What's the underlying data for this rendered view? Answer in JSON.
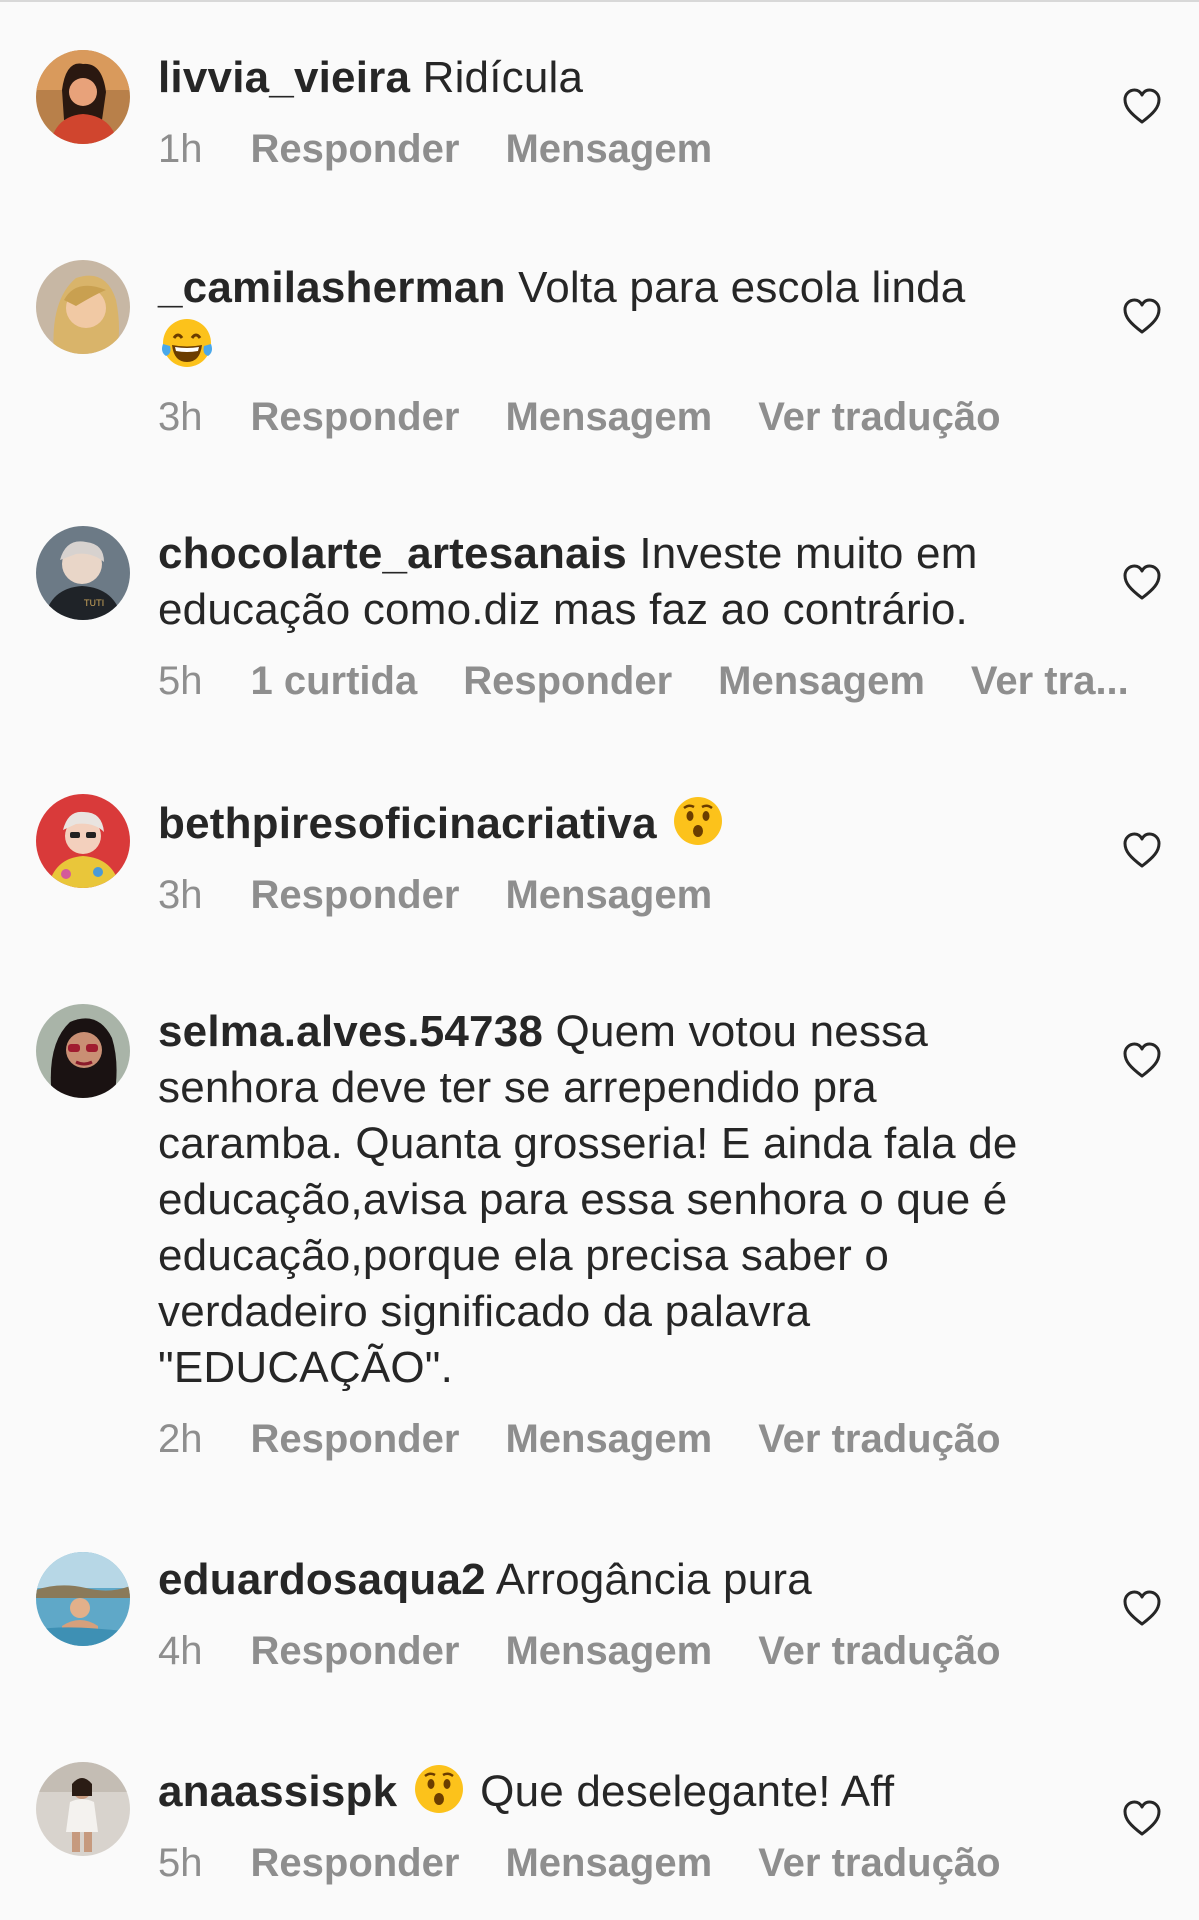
{
  "comments": [
    {
      "username": "livvia_vieira",
      "text": "Ridícula",
      "time": "1h",
      "actions": [
        "Responder",
        "Mensagem"
      ]
    },
    {
      "username": "_camilasherman",
      "text": "Volta para escola linda",
      "emoji": "face-with-tears-of-joy",
      "time": "3h",
      "actions": [
        "Responder",
        "Mensagem",
        "Ver tradução"
      ]
    },
    {
      "username": "chocolarte_artesanais",
      "text": "Investe muito em educação como.diz mas faz ao contrário.",
      "time": "5h",
      "likes": "1 curtida",
      "actions": [
        "Responder",
        "Mensagem",
        "Ver tra..."
      ]
    },
    {
      "username": "bethpiresoficinacriativa",
      "text": "",
      "emoji": "hushed-face",
      "time": "3h",
      "actions": [
        "Responder",
        "Mensagem"
      ]
    },
    {
      "username": "selma.alves.54738",
      "text": "Quem votou nessa senhora deve ter se arrependido pra caramba. Quanta grosseria! E ainda fala de educação,avisa para essa senhora o que é educação,porque ela precisa saber o verdadeiro significado da palavra \"EDUCAÇÃO\".",
      "time": "2h",
      "actions": [
        "Responder",
        "Mensagem",
        "Ver tradução"
      ]
    },
    {
      "username": "eduardosaqua2",
      "text": "Arrogância pura",
      "time": "4h",
      "actions": [
        "Responder",
        "Mensagem",
        "Ver tradução"
      ]
    },
    {
      "username": "anaassispk",
      "text": "Que deselegante! Aff",
      "emoji": "hushed-face",
      "time": "5h",
      "actions": [
        "Responder",
        "Mensagem",
        "Ver tradução"
      ]
    }
  ],
  "icons": {
    "like": "heart-outline-icon"
  },
  "colors": {
    "text": "#262626",
    "secondary": "#8e8e8e",
    "background": "#fafafa"
  }
}
